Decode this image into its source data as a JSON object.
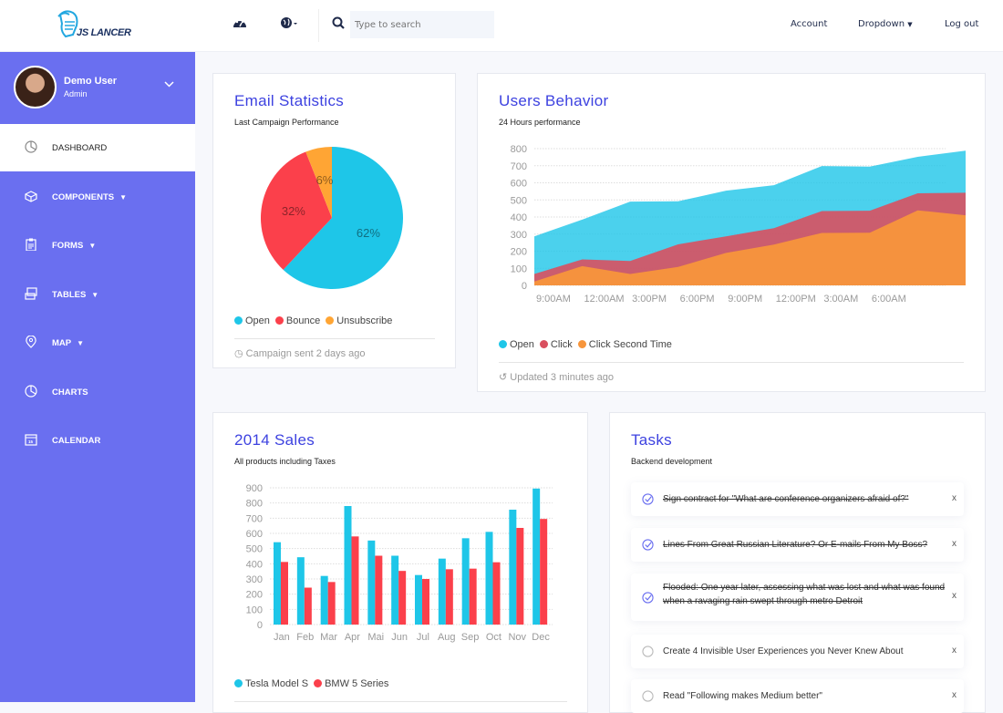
{
  "brand": {
    "logo_text": "JS LANCER",
    "accent": "#6a6ff0",
    "title_color": "#3d42e0"
  },
  "topbar": {
    "icons": [
      "dashboard-gauge-icon",
      "globe-icon"
    ],
    "search_placeholder": "Type to search",
    "links": {
      "account": "Account",
      "dropdown": "Dropdown",
      "logout": "Log out"
    }
  },
  "sidebar": {
    "user": {
      "name": "Demo User",
      "role": "Admin"
    },
    "items": [
      {
        "label": "DASHBOARD",
        "icon": "pie-chart-icon",
        "active": true,
        "caret": false
      },
      {
        "label": "COMPONENTS",
        "icon": "cube-icon",
        "active": false,
        "caret": true
      },
      {
        "label": "FORMS",
        "icon": "clipboard-icon",
        "active": false,
        "caret": true
      },
      {
        "label": "TABLES",
        "icon": "table-icon",
        "active": false,
        "caret": true
      },
      {
        "label": "MAP",
        "icon": "map-pin-icon",
        "active": false,
        "caret": true
      },
      {
        "label": "CHARTS",
        "icon": "pie-chart-icon",
        "active": false,
        "caret": false
      },
      {
        "label": "CALENDAR",
        "icon": "calendar-icon",
        "active": false,
        "caret": false
      }
    ]
  },
  "email": {
    "title": "Email Statistics",
    "subtitle": "Last Campaign Performance",
    "footer": "Campaign sent 2 days ago"
  },
  "behavior": {
    "title": "Users Behavior",
    "subtitle": "24 Hours performance",
    "footer": "Updated 3 minutes ago"
  },
  "sales": {
    "title": "2014 Sales",
    "subtitle": "All products including Taxes"
  },
  "tasks": {
    "title": "Tasks",
    "subtitle": "Backend development",
    "items": [
      {
        "text": "Sign contract for \"What are conference organizers afraid of?\"",
        "done": true
      },
      {
        "text": "Lines From Great Russian Literature? Or E-mails From My Boss?",
        "done": true
      },
      {
        "text": "Flooded: One year later, assessing what was lost and what was found when a ravaging rain swept through metro Detroit",
        "done": true
      },
      {
        "text": "Create 4 Invisible User Experiences you Never Knew About",
        "done": false
      },
      {
        "text": "Read \"Following makes Medium better\"",
        "done": false
      }
    ],
    "remove_label": "x"
  },
  "chart_data": [
    {
      "type": "pie",
      "title": "Email Statistics",
      "categories": [
        "Open",
        "Bounce",
        "Unsubscribe"
      ],
      "values": [
        62,
        32,
        6
      ],
      "labels": [
        "62%",
        "32%",
        "6%"
      ],
      "colors": [
        "#1ec6e8",
        "#fb404b",
        "#ffa534"
      ],
      "legend": "bottom-left"
    },
    {
      "type": "area",
      "title": "Users Behavior",
      "x": [
        "9:00AM",
        "12:00AM",
        "3:00PM",
        "6:00PM",
        "9:00PM",
        "12:00PM",
        "3:00AM",
        "6:00AM"
      ],
      "series": [
        {
          "name": "Open",
          "color": "#1ec6e8",
          "values": [
            287,
            385,
            490,
            492,
            554,
            586,
            698,
            695,
            752,
            788
          ]
        },
        {
          "name": "Click",
          "color": "#d9505f",
          "values": [
            67,
            152,
            143,
            240,
            287,
            335,
            435,
            437,
            539,
            542
          ]
        },
        {
          "name": "Click Second Time",
          "color": "#f7953b",
          "values": [
            23,
            113,
            67,
            108,
            190,
            239,
            307,
            308,
            439,
            410
          ]
        }
      ],
      "ylim": [
        0,
        800
      ],
      "yticks": [
        0,
        100,
        200,
        300,
        400,
        500,
        600,
        700,
        800
      ],
      "grid": true,
      "legend": "bottom-left"
    },
    {
      "type": "bar",
      "title": "2014 Sales",
      "categories": [
        "Jan",
        "Feb",
        "Mar",
        "Apr",
        "Mai",
        "Jun",
        "Jul",
        "Aug",
        "Sep",
        "Oct",
        "Nov",
        "Dec"
      ],
      "series": [
        {
          "name": "Tesla Model S",
          "color": "#1ec6e8",
          "values": [
            542,
            443,
            320,
            780,
            553,
            453,
            326,
            434,
            568,
            610,
            756,
            895
          ]
        },
        {
          "name": "BMW 5 Series",
          "color": "#fb404b",
          "values": [
            412,
            243,
            280,
            580,
            453,
            353,
            300,
            364,
            368,
            410,
            636,
            695
          ]
        }
      ],
      "ylim": [
        0,
        900
      ],
      "yticks": [
        0,
        100,
        200,
        300,
        400,
        500,
        600,
        700,
        800,
        900
      ],
      "grid": true,
      "legend": "bottom-left"
    }
  ]
}
